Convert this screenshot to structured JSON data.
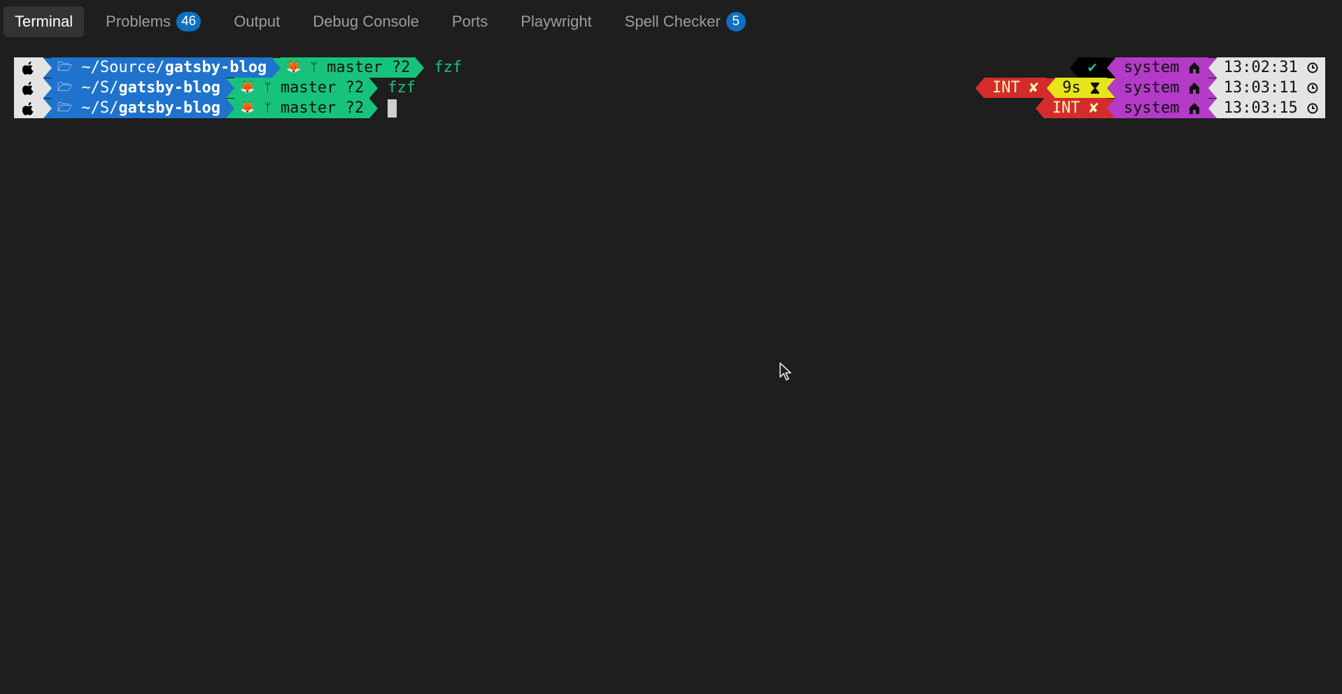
{
  "tabs": [
    {
      "label": "Terminal",
      "active": true
    },
    {
      "label": "Problems",
      "badge": "46"
    },
    {
      "label": "Output"
    },
    {
      "label": "Debug Console"
    },
    {
      "label": "Ports"
    },
    {
      "label": "Playwright"
    },
    {
      "label": "Spell Checker",
      "badge": "5"
    }
  ],
  "prompt": {
    "line1": {
      "dir_prefix": "~/Source/",
      "dir_name": "gatsby-blog",
      "branch": "master ?2",
      "command": "fzf"
    },
    "line2": {
      "dir_prefix": "~/S/",
      "dir_name": "gatsby-blog",
      "branch": "master ?2",
      "command": "fzf"
    },
    "line3": {
      "dir_prefix": "~/S/",
      "dir_name": "gatsby-blog",
      "branch": "master ?2",
      "command": ""
    }
  },
  "rprompt": {
    "line1": {
      "status": "✔",
      "env": "system",
      "time": "13:02:31"
    },
    "line2": {
      "status": "INT ✘",
      "duration": "9s",
      "env": "system",
      "time": "13:03:11"
    },
    "line3": {
      "status": "INT ✘",
      "env": "system",
      "time": "13:03:15"
    }
  },
  "colors": {
    "background": "#1e1e1e",
    "dir_segment": "#1f73cc",
    "git_segment": "#17c37b",
    "error_segment": "#d42c2c",
    "duration_segment": "#e5e51a",
    "env_segment": "#b43ac8",
    "badge": "#0e70c0"
  },
  "icons": {
    "os": "apple-icon",
    "folder": "folder-open-icon",
    "vcs": "gitlab-icon",
    "branch": "git-branch-icon",
    "duration": "hourglass-icon",
    "env": "home-icon",
    "time": "clock-icon"
  }
}
